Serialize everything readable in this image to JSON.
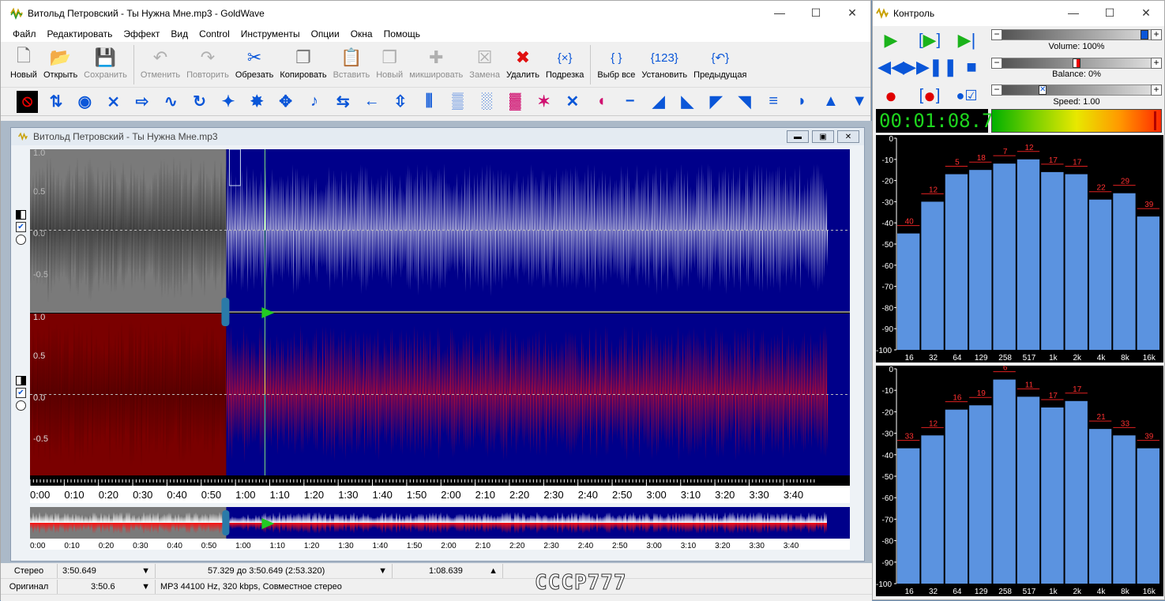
{
  "main": {
    "title": "Витольд Петровский - Ты Нужна Мне.mp3 - GoldWave",
    "menu": [
      "Файл",
      "Редактировать",
      "Эффект",
      "Вид",
      "Control",
      "Инструменты",
      "Опции",
      "Окна",
      "Помощь"
    ],
    "toolbar": [
      {
        "label": "Новый",
        "icon": "new-file-icon",
        "enabled": true
      },
      {
        "label": "Открыть",
        "icon": "open-folder-icon",
        "enabled": true
      },
      {
        "label": "Сохранить",
        "icon": "save-icon",
        "enabled": false
      },
      {
        "label": "Отменить",
        "icon": "undo-icon",
        "enabled": false
      },
      {
        "label": "Повторить",
        "icon": "redo-icon",
        "enabled": false
      },
      {
        "label": "Обрезать",
        "icon": "scissors-icon",
        "enabled": true
      },
      {
        "label": "Копировать",
        "icon": "copy-icon",
        "enabled": true
      },
      {
        "label": "Вставить",
        "icon": "paste-icon",
        "enabled": false
      },
      {
        "label": "Новый",
        "icon": "paste-new-icon",
        "enabled": false
      },
      {
        "label": "микшировать",
        "icon": "mix-icon",
        "enabled": false
      },
      {
        "label": "Замена",
        "icon": "replace-icon",
        "enabled": false
      },
      {
        "label": "Удалить",
        "icon": "delete-icon",
        "enabled": true
      },
      {
        "label": "Подрезка",
        "icon": "trim-icon",
        "enabled": true
      },
      {
        "label": "Выбр все",
        "icon": "select-all-icon",
        "enabled": true
      },
      {
        "label": "Установить",
        "icon": "set-selection-icon",
        "enabled": true
      },
      {
        "label": "Предыдущая",
        "icon": "previous-selection-icon",
        "enabled": true
      }
    ],
    "effects_icons": [
      "stop-effect-icon",
      "change-pitch-icon",
      "doppler-icon",
      "dynamics-icon",
      "echo-icon",
      "equalizer-wave-icon",
      "loop-icon",
      "flanger-icon",
      "mechanize-icon",
      "offset-icon",
      "pitch-icon",
      "reverb-icon",
      "playback-rate-icon",
      "resample-icon",
      "reverse-icon",
      "silence-icon",
      "volume-shape-icon",
      "spectrum-filter-icon",
      "noise-reduction-icon",
      "time-warp-icon",
      "invert-icon",
      "channel-mixer-icon",
      "pan-icon",
      "echo-volume-icon",
      "fade-in-icon",
      "fade-out-icon",
      "match-volume-icon",
      "volume-icon",
      "maximize-icon",
      "normalize-icon"
    ],
    "child_title": "Витольд Петровский - Ты Нужна Мне.mp3",
    "amp_labels_top": [
      "1.0",
      "0.5",
      "0.0",
      "-0.5"
    ],
    "amp_labels_bottom": [
      "1.0",
      "0.5",
      "0.0",
      "-0.5"
    ],
    "time_labels": [
      "0:00",
      "0:10",
      "0:20",
      "0:30",
      "0:40",
      "0:50",
      "1:00",
      "1:10",
      "1:20",
      "1:30",
      "1:40",
      "1:50",
      "2:00",
      "2:10",
      "2:20",
      "2:30",
      "2:40",
      "2:50",
      "3:00",
      "3:10",
      "3:20",
      "3:30",
      "3:40"
    ],
    "selection": {
      "start_sec": 57.3,
      "end_sec": 230.6,
      "cursor_sec": 68.6,
      "total_sec": 230.649
    },
    "status": {
      "channels": "Стерео",
      "length": "3:50.649",
      "range": "57.329 до 3:50.649 (2:53.320)",
      "position": "1:08.639",
      "original_label": "Оригинал",
      "original_length": "3:50.6",
      "format": "MP3 44100 Hz, 320 kbps, Совместное стерео"
    },
    "watermark": "CCCP777"
  },
  "control": {
    "title": "Контроль",
    "volume_label": "Volume: 100%",
    "volume": 1.0,
    "balance_label": "Balance: 0%",
    "balance": 0.5,
    "speed_label": "Speed: 1.00",
    "speed": 0.25,
    "time": "00:01:08.7",
    "icons": [
      "play-icon",
      "play-selection-icon",
      "play-to-end-icon",
      "rewind-icon",
      "fast-forward-icon",
      "pause-icon",
      "stop-icon",
      "record-icon",
      "record-selection-icon",
      "record-options-icon"
    ]
  },
  "chart_data": [
    {
      "type": "bar",
      "title": "",
      "categories": [
        "16",
        "32",
        "64",
        "129",
        "258",
        "517",
        "1k",
        "2k",
        "4k",
        "8k",
        "16k"
      ],
      "values": [
        -45,
        -30,
        -17,
        -15,
        -12,
        -10,
        -16,
        -17,
        -29,
        -26,
        -37
      ],
      "peak_labels": [
        "40",
        "12",
        "5",
        "18",
        "7",
        "12",
        "17",
        "17",
        "22",
        "29",
        "39"
      ],
      "y_ticks": [
        "0",
        "-10",
        "-20",
        "-30",
        "-40",
        "-50",
        "-60",
        "-70",
        "-80",
        "-90",
        "-100"
      ],
      "ylim": [
        -100,
        0
      ]
    },
    {
      "type": "bar",
      "title": "",
      "categories": [
        "16",
        "32",
        "64",
        "129",
        "258",
        "517",
        "1k",
        "2k",
        "4k",
        "8k",
        "16k"
      ],
      "values": [
        -37,
        -31,
        -19,
        -17,
        -5,
        -13,
        -18,
        -15,
        -28,
        -31,
        -37
      ],
      "peak_labels": [
        "33",
        "12",
        "16",
        "19",
        "6",
        "11",
        "17",
        "17",
        "21",
        "33",
        "39"
      ],
      "y_ticks": [
        "0",
        "-10",
        "-20",
        "-30",
        "-40",
        "-50",
        "-60",
        "-70",
        "-80",
        "-90",
        "-100"
      ],
      "ylim": [
        -100,
        0
      ]
    }
  ]
}
